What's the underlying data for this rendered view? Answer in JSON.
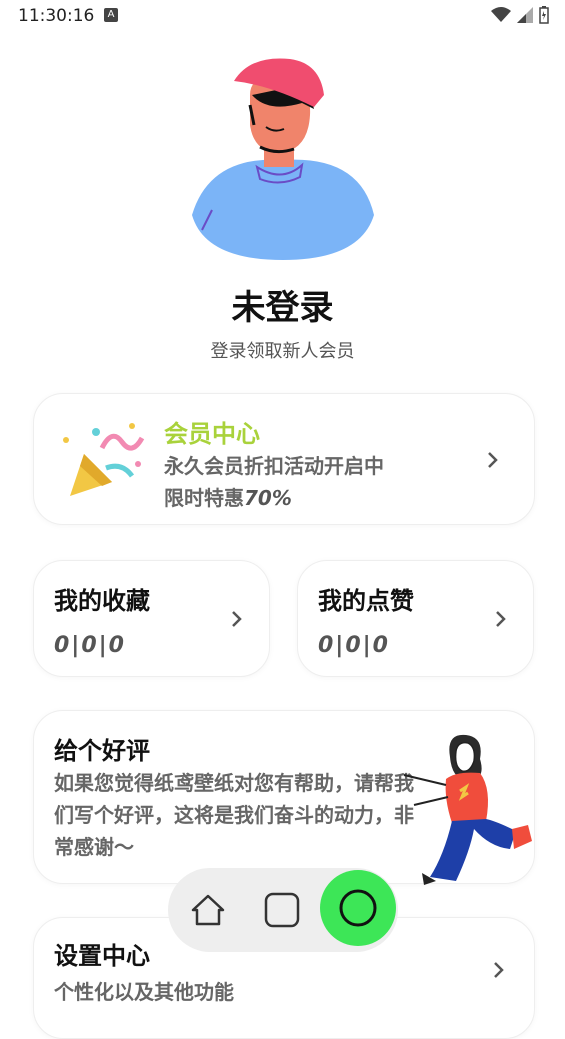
{
  "status_bar": {
    "time": "11:30:16",
    "notification_badge": "A"
  },
  "profile": {
    "title": "未登录",
    "subtitle": "登录领取新人会员"
  },
  "vip": {
    "title": "会员中心",
    "desc": "永久会员折扣活动开启中",
    "desc2_prefix": "限时特惠",
    "desc2_value": "70%"
  },
  "favorites": {
    "title": "我的收藏",
    "count": "0|0|0"
  },
  "likes": {
    "title": "我的点赞",
    "count": "0|0|0"
  },
  "review": {
    "title": "给个好评",
    "desc": "如果您觉得纸鸢壁纸对您有帮助，请帮我们写个好评，这将是我们奋斗的动力，非常感谢～"
  },
  "settings": {
    "title": "设置中心",
    "desc": "个性化以及其他功能"
  },
  "colors": {
    "vip_accent": "#a9d23b",
    "nav_active": "#3de657",
    "avatar_shirt": "#7bb4f7",
    "avatar_cap": "#f04d6f"
  },
  "icons": {
    "nav": [
      "home-icon",
      "square-icon",
      "circle-icon"
    ]
  }
}
